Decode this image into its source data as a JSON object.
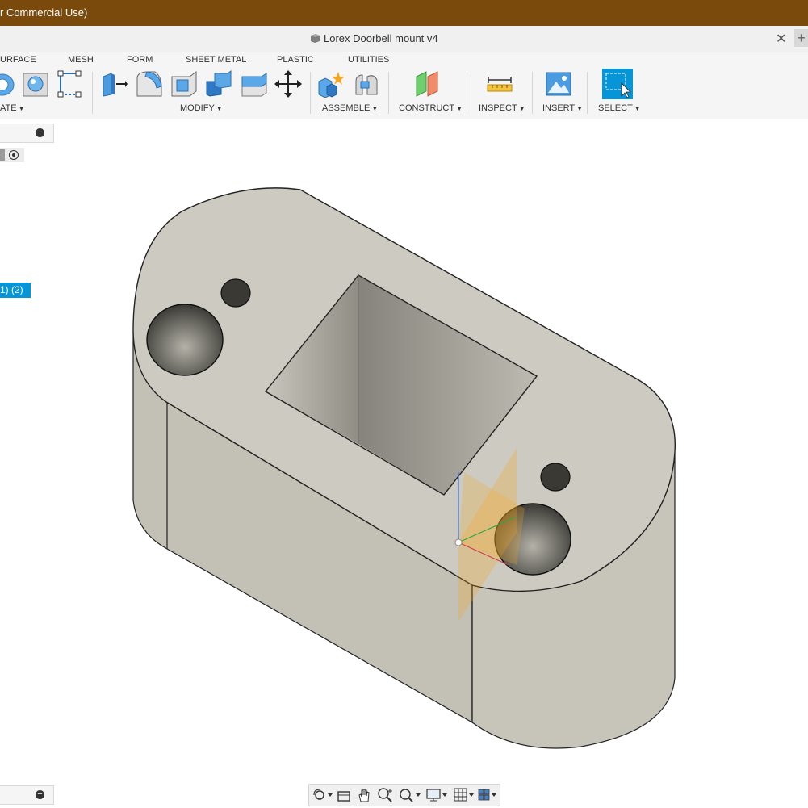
{
  "app": {
    "title_fragment": "r Commercial Use)"
  },
  "document": {
    "tab_title": "Lorex Doorbell mount v4",
    "close_symbol": "✕",
    "new_tab_symbol": "+"
  },
  "workspace_tabs": [
    "URFACE",
    "MESH",
    "FORM",
    "SHEET METAL",
    "PLASTIC",
    "UTILITIES"
  ],
  "groups": {
    "create": "ATE",
    "modify": "MODIFY",
    "assemble": "ASSEMBLE",
    "construct": "CONSTRUCT",
    "inspect": "INSPECT",
    "insert": "INSERT",
    "select": "SELECT"
  },
  "browser": {
    "selected_item": "1) (2)"
  },
  "colors": {
    "titlebar": "#7a4a0c",
    "accent": "#0696d7",
    "model_face": "#cdcbc1",
    "model_side": "#c3c1b6"
  },
  "icons": [
    "cube-doc-icon",
    "revolve-icon",
    "hole-icon",
    "sketch-dimension-icon",
    "press-pull-icon",
    "fillet-icon",
    "shell-icon",
    "combine-icon",
    "offset-face-icon",
    "move-icon",
    "new-component-icon",
    "joint-icon",
    "offset-plane-icon",
    "measure-icon",
    "insert-image-icon",
    "select-window-icon",
    "orbit-icon",
    "look-at-icon",
    "pan-icon",
    "zoom-icon",
    "fit-icon",
    "display-settings-icon",
    "grid-icon",
    "viewports-icon"
  ]
}
